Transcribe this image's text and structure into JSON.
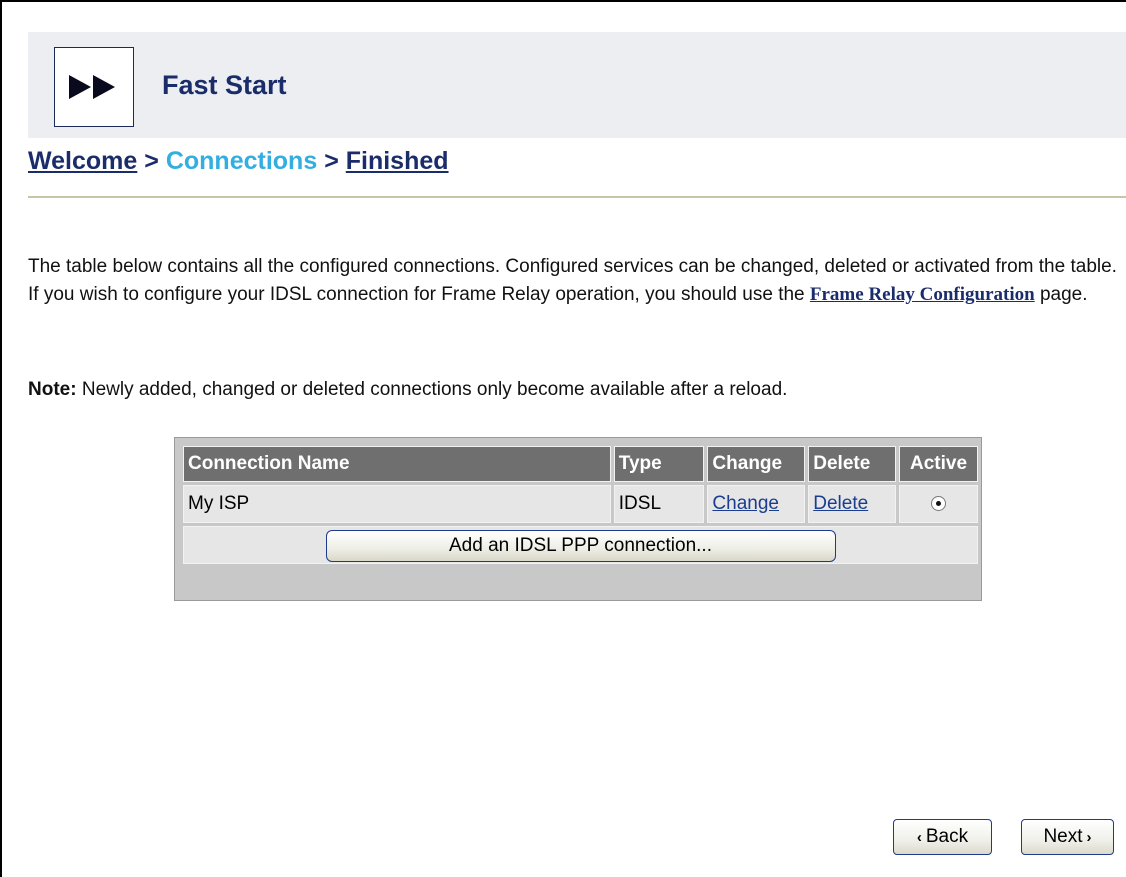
{
  "header": {
    "title": "Fast Start",
    "logo_icon": "fast-forward-icon"
  },
  "breadcrumb": {
    "items": [
      "Welcome",
      "Connections",
      "Finished"
    ],
    "separator": ">"
  },
  "intro": {
    "text_before": "The table below contains all the configured connections. Configured services can be changed, deleted or activated from the table. If you wish to configure your IDSL connection for Frame Relay operation, you should use the ",
    "link": "Frame Relay Configuration",
    "text_after": " page."
  },
  "note": {
    "label": "Note:",
    "text": " Newly added, changed or deleted connections only become available after a reload."
  },
  "table": {
    "headers": [
      "Connection Name",
      "Type",
      "Change",
      "Delete",
      "Active"
    ],
    "rows": [
      {
        "name": "My ISP",
        "type": "IDSL",
        "change": "Change",
        "delete": "Delete",
        "active": true
      }
    ],
    "add_button": "Add an IDSL PPP connection..."
  },
  "nav": {
    "back": "Back",
    "next": "Next",
    "back_icon": "chevron-left-icon",
    "next_icon": "chevron-right-icon"
  }
}
